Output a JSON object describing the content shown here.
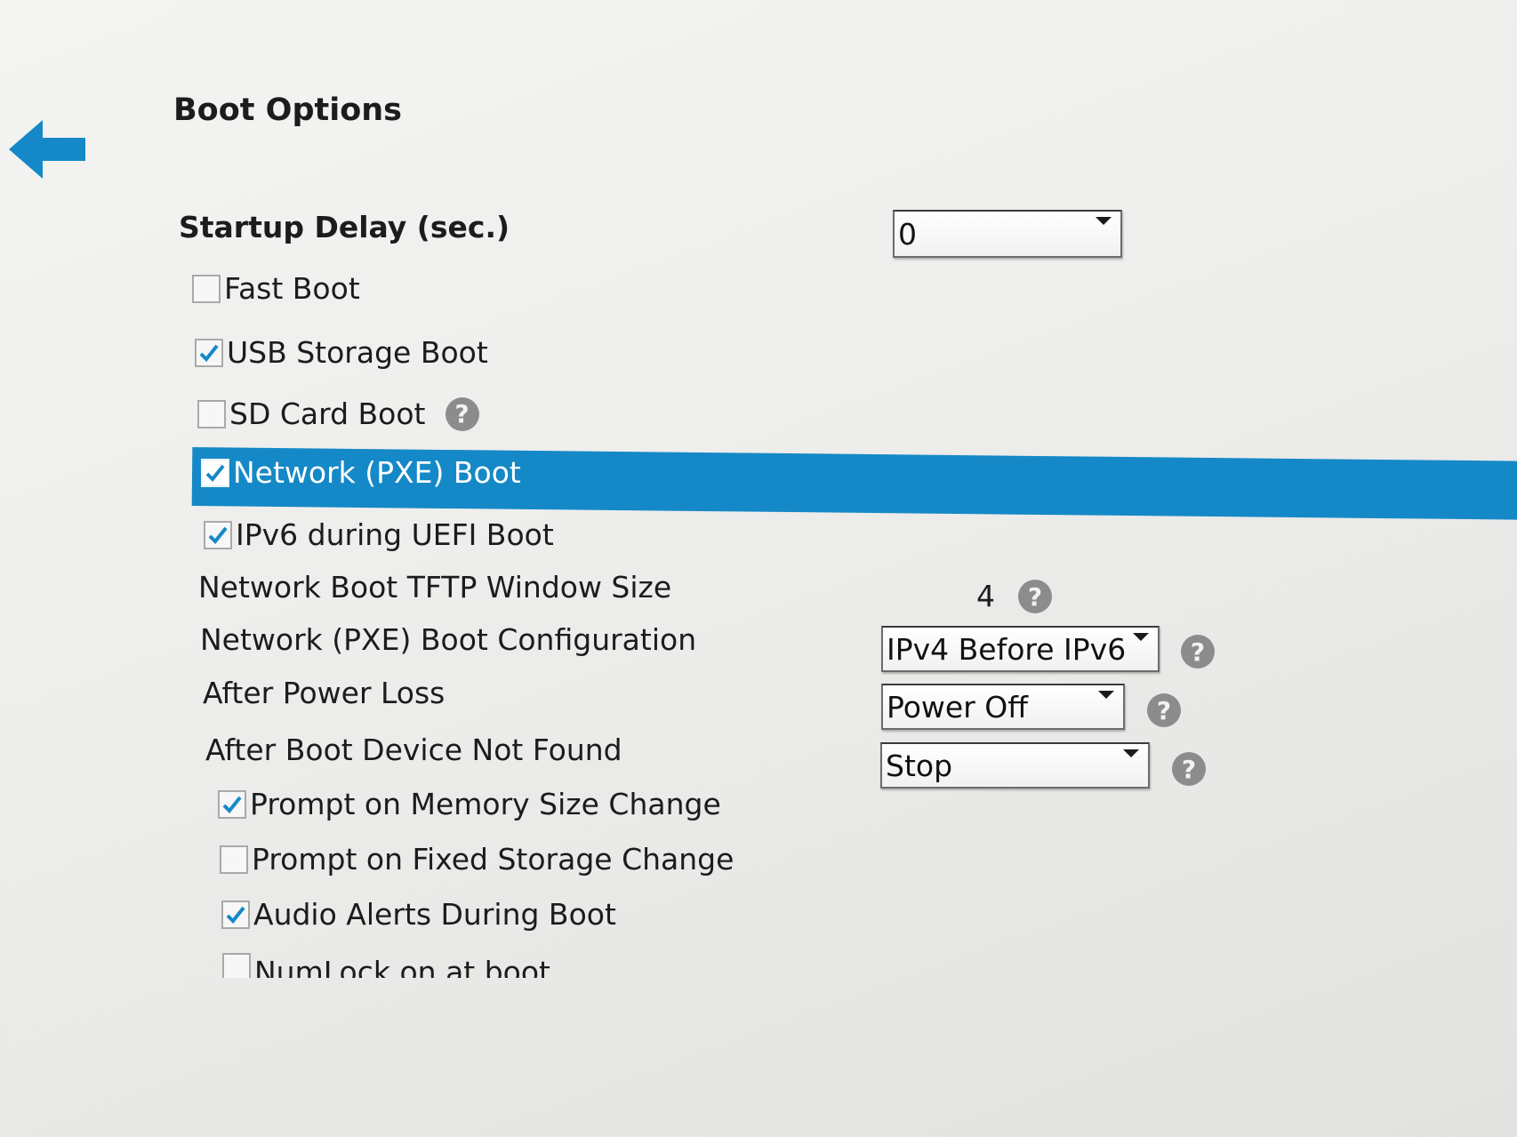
{
  "header": {
    "title": "Boot Options",
    "back_icon": "back-arrow-icon",
    "accent_color": "#1589c7"
  },
  "startup_delay": {
    "label": "Startup Delay (sec.)",
    "value": "0"
  },
  "options": [
    {
      "label": "Fast Boot",
      "checked": false
    },
    {
      "label": "USB Storage Boot",
      "checked": true
    },
    {
      "label": "SD Card Boot",
      "checked": false,
      "help": "?"
    },
    {
      "label": "Network (PXE) Boot",
      "checked": true,
      "selected": true
    },
    {
      "label": "IPv6 during UEFI Boot",
      "checked": true
    }
  ],
  "tftp": {
    "label": "Network Boot TFTP Window Size",
    "value": "4",
    "help": "?"
  },
  "pxe_config": {
    "label": "Network (PXE) Boot Configuration",
    "value": "IPv4 Before IPv6",
    "help": "?"
  },
  "power_loss": {
    "label": "After Power Loss",
    "value": "Power Off",
    "help": "?"
  },
  "device_not_found": {
    "label": "After Boot Device Not Found",
    "value": "Stop",
    "help": "?"
  },
  "prompts": [
    {
      "label": "Prompt on Memory Size Change",
      "checked": true
    },
    {
      "label": "Prompt on Fixed Storage Change",
      "checked": false
    },
    {
      "label": "Audio Alerts During Boot",
      "checked": true
    }
  ],
  "cut_off_option": {
    "label": "NumLock on at boot",
    "checked": false
  }
}
